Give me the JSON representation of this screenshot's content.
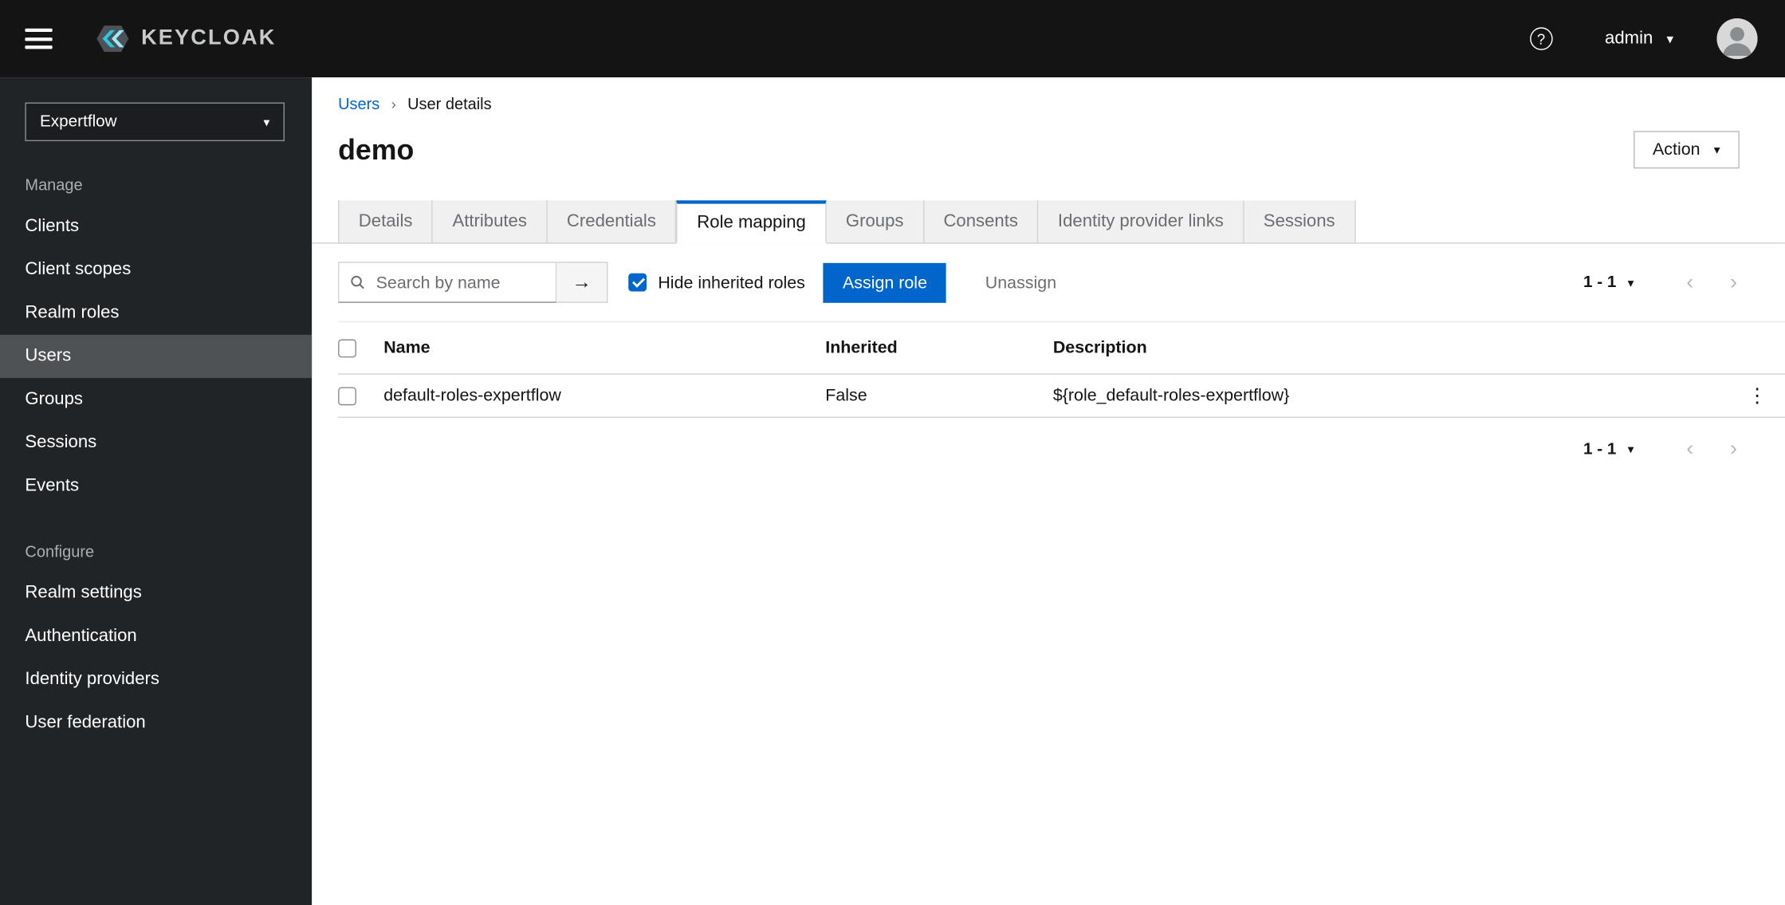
{
  "masthead": {
    "brand": "KEYCLOAK",
    "username": "admin"
  },
  "icons": {
    "caret_down": "▾",
    "chevron_left": "‹",
    "chevron_right": "›",
    "breadcrumb_sep": "›",
    "kebab": "⋮",
    "search_arrow": "→",
    "help": "?"
  },
  "sidebar": {
    "realm_selector": "Expertflow",
    "sections": [
      {
        "label": "Manage",
        "items": [
          {
            "label": "Clients"
          },
          {
            "label": "Client scopes"
          },
          {
            "label": "Realm roles"
          },
          {
            "label": "Users",
            "active": true
          },
          {
            "label": "Groups"
          },
          {
            "label": "Sessions"
          },
          {
            "label": "Events"
          }
        ]
      },
      {
        "label": "Configure",
        "items": [
          {
            "label": "Realm settings"
          },
          {
            "label": "Authentication"
          },
          {
            "label": "Identity providers"
          },
          {
            "label": "User federation"
          }
        ]
      }
    ]
  },
  "breadcrumb": {
    "parent": "Users",
    "current": "User details"
  },
  "page": {
    "title": "demo",
    "action_button": "Action"
  },
  "tabs": [
    {
      "label": "Details"
    },
    {
      "label": "Attributes"
    },
    {
      "label": "Credentials"
    },
    {
      "label": "Role mapping",
      "active": true
    },
    {
      "label": "Groups"
    },
    {
      "label": "Consents"
    },
    {
      "label": "Identity provider links"
    },
    {
      "label": "Sessions"
    }
  ],
  "toolbar": {
    "search_placeholder": "Search by name",
    "hide_inherited_label": "Hide inherited roles",
    "hide_inherited_checked": true,
    "assign_button": "Assign role",
    "unassign_button": "Unassign",
    "pagination_range": "1 - 1"
  },
  "table": {
    "columns": [
      "Name",
      "Inherited",
      "Description"
    ],
    "rows": [
      {
        "name": "default-roles-expertflow",
        "inherited": "False",
        "description": "${role_default-roles-expertflow}"
      }
    ]
  },
  "footer": {
    "pagination_range": "1 - 1"
  }
}
